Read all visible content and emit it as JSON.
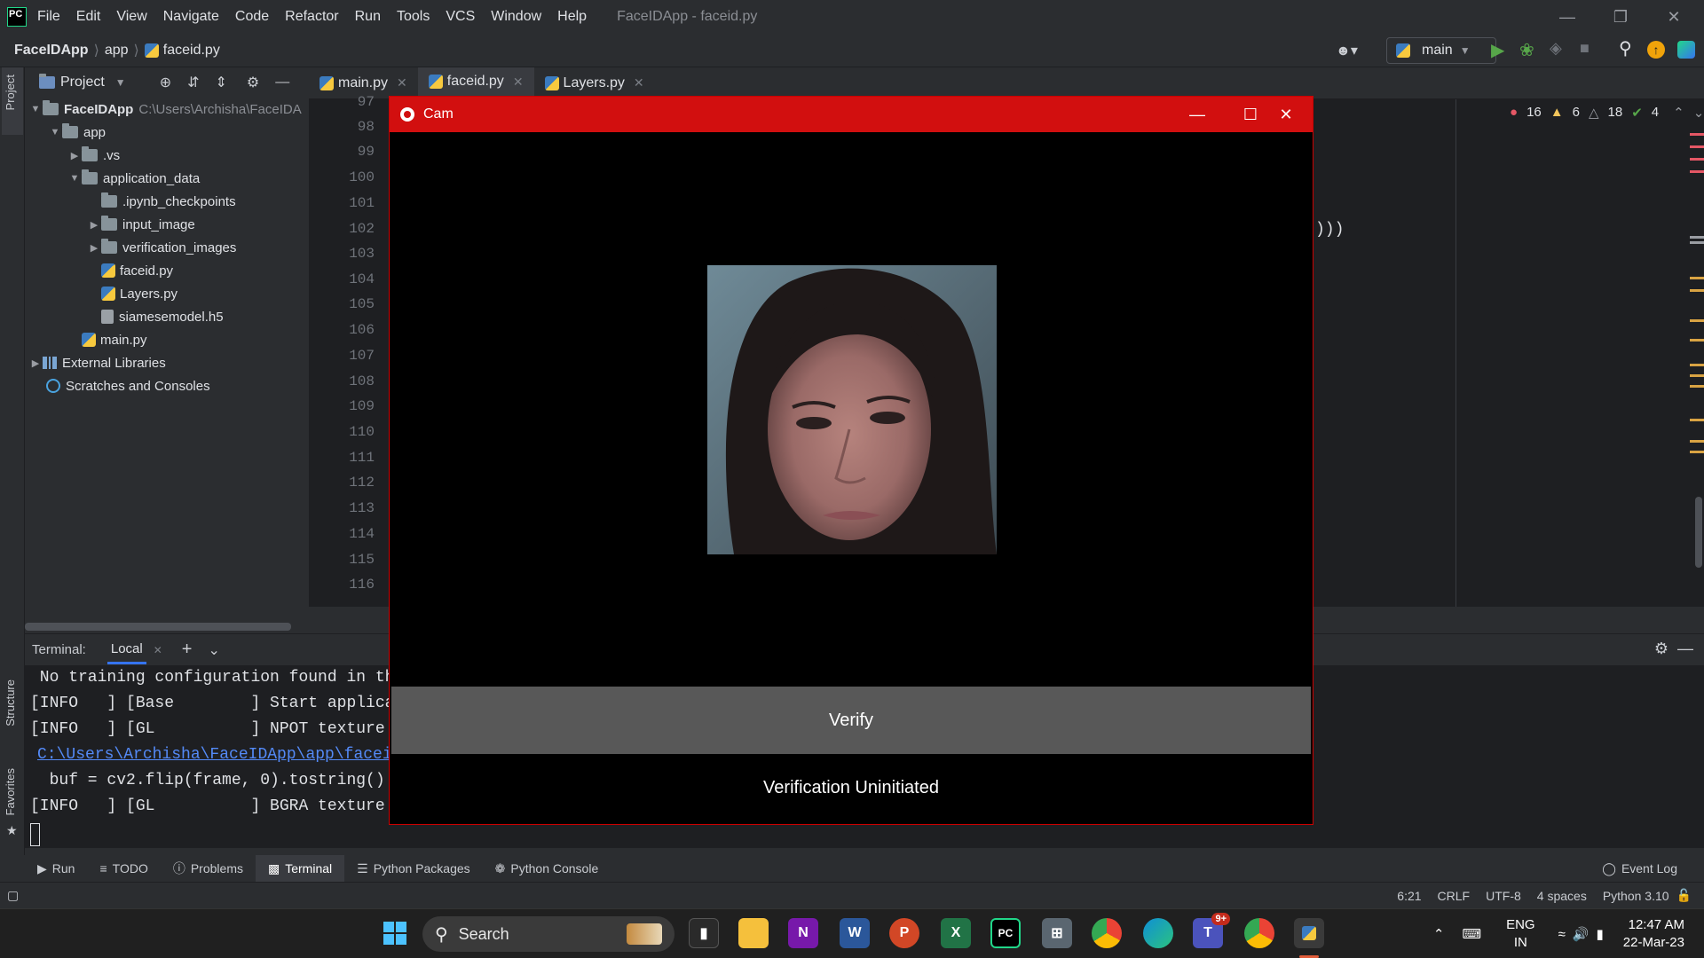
{
  "app": {
    "logo_text": "PC",
    "window_title": "FaceIDApp - faceid.py"
  },
  "menu": [
    "File",
    "Edit",
    "View",
    "Navigate",
    "Code",
    "Refactor",
    "Run",
    "Tools",
    "VCS",
    "Window",
    "Help"
  ],
  "breadcrumb": {
    "project": "FaceIDApp",
    "folder": "app",
    "file": "faceid.py"
  },
  "run_config": "main",
  "project_panel": {
    "title": "Project",
    "root": "FaceIDApp",
    "root_path": "C:\\Users\\Archisha\\FaceIDA",
    "items": [
      {
        "label": "app"
      },
      {
        "label": ".vs"
      },
      {
        "label": "application_data"
      },
      {
        "label": ".ipynb_checkpoints"
      },
      {
        "label": "input_image"
      },
      {
        "label": "verification_images"
      },
      {
        "label": "faceid.py"
      },
      {
        "label": "Layers.py"
      },
      {
        "label": "siamesemodel.h5"
      },
      {
        "label": "main.py"
      },
      {
        "label": "External Libraries"
      },
      {
        "label": "Scratches and Consoles"
      }
    ]
  },
  "editor": {
    "tabs": [
      {
        "label": "main.py"
      },
      {
        "label": "faceid.py"
      },
      {
        "label": "Layers.py"
      }
    ],
    "line_numbers": [
      "97",
      "98",
      "99",
      "100",
      "101",
      "102",
      "103",
      "104",
      "105",
      "106",
      "107",
      "108",
      "109",
      "110",
      "111",
      "112",
      "113",
      "114",
      "115",
      "116"
    ],
    "visible_code_fragment": ")))",
    "inspections": {
      "errors": "16",
      "warnings": "6",
      "weak_warnings": "18",
      "ok": "4"
    }
  },
  "terminal": {
    "label": "Terminal:",
    "tab": "Local",
    "lines": [
      " No training configuration found in the",
      "[INFO   ] [Base        ] Start applicat",
      "[INFO   ] [GL          ] NPOT texture s",
      "C:\\Users\\Archisha\\FaceIDApp\\app\\faceid",
      "  buf = cv2.flip(frame, 0).tostring()",
      "[INFO   ] [GL          ] BGRA texture s"
    ]
  },
  "bottom_tabs": [
    {
      "label": "Run"
    },
    {
      "label": "TODO"
    },
    {
      "label": "Problems"
    },
    {
      "label": "Terminal"
    },
    {
      "label": "Python Packages"
    },
    {
      "label": "Python Console"
    }
  ],
  "event_log": "Event Log",
  "side_labels": {
    "project": "Project",
    "structure": "Structure",
    "favorites": "Favorites"
  },
  "status": {
    "position": "6:21",
    "line_sep": "CRLF",
    "encoding": "UTF-8",
    "indent": "4 spaces",
    "interpreter": "Python 3.10"
  },
  "cam_window": {
    "title": "Cam",
    "verify_label": "Verify",
    "status_text": "Verification Uninitiated"
  },
  "taskbar": {
    "search_label": "Search",
    "lang": "ENG",
    "region": "IN",
    "time": "12:47 AM",
    "date": "22-Mar-23",
    "teams_badge": "9+"
  },
  "colors": {
    "cam_title": "#d20f0f",
    "accent": "#3574f0",
    "verify_bg": "#585858"
  }
}
